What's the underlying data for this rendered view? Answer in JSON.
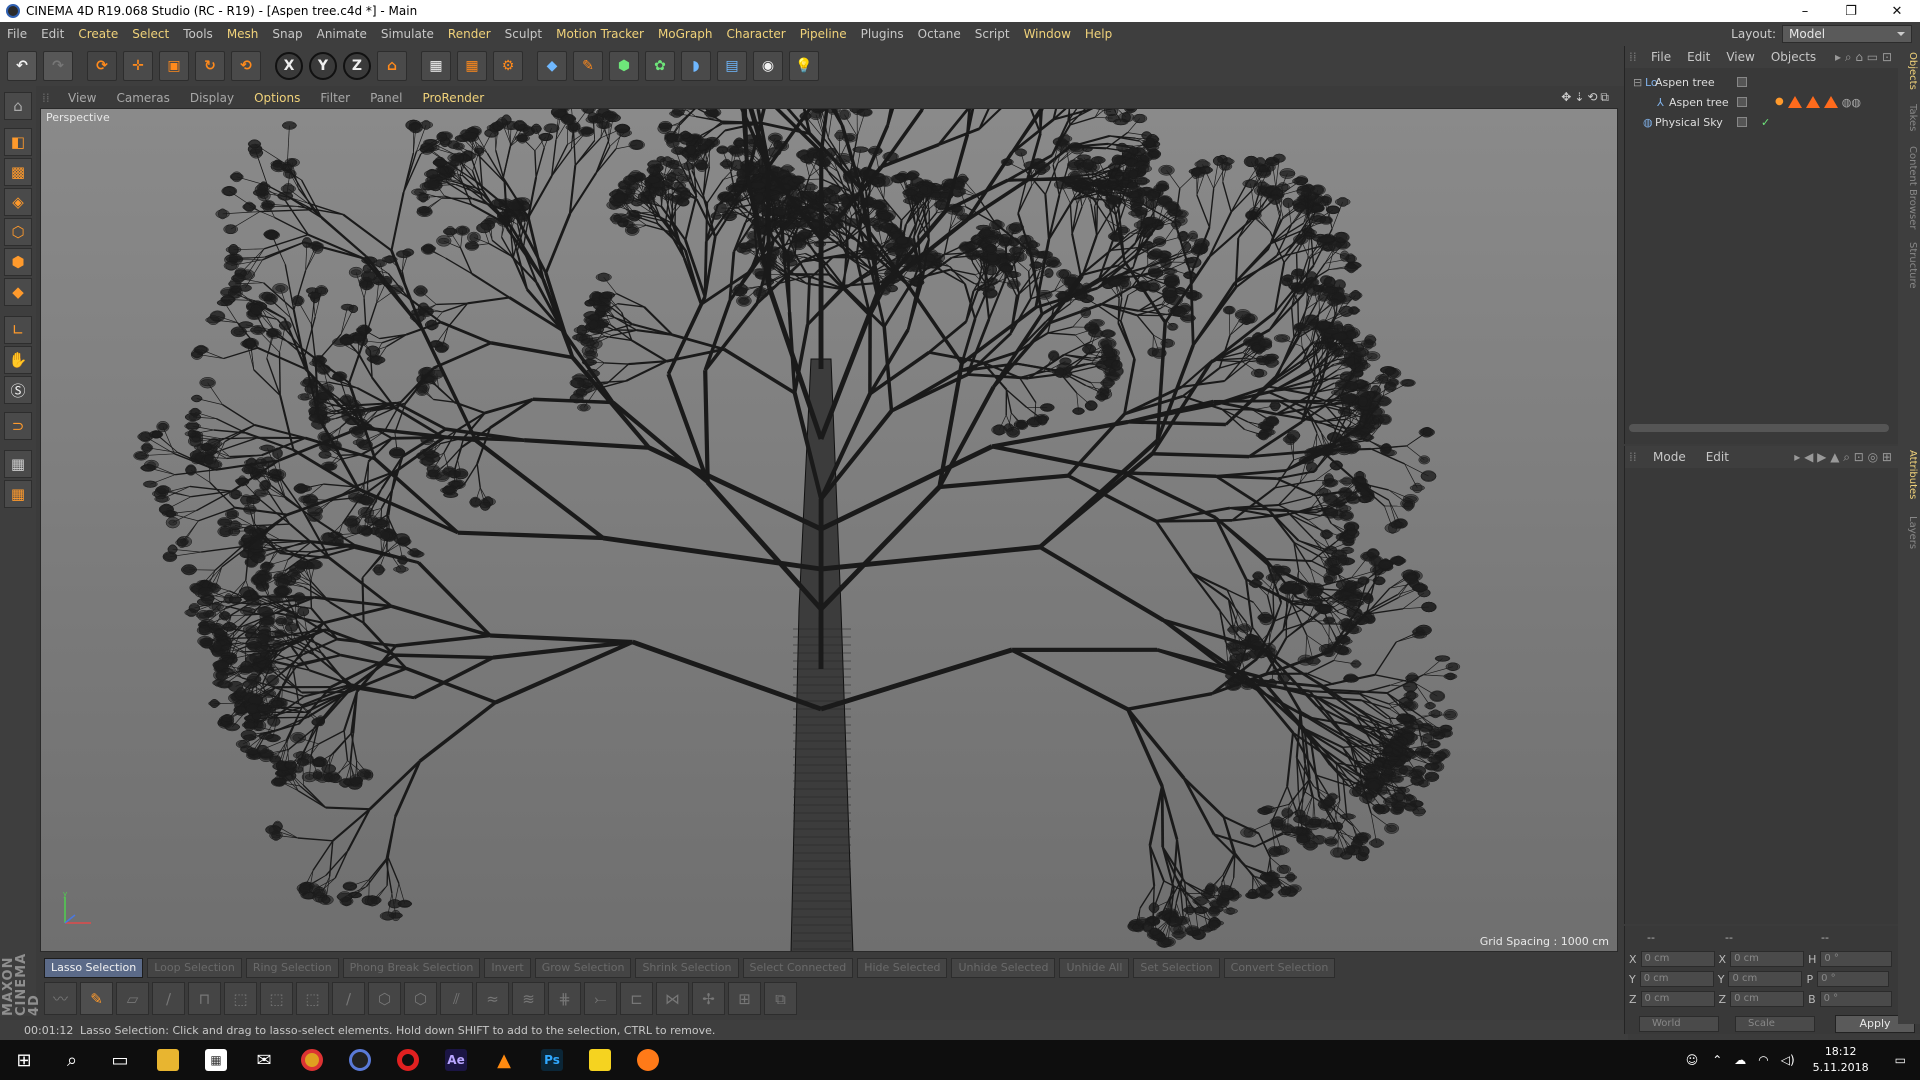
{
  "window": {
    "title": "CINEMA 4D R19.068 Studio (RC - R19) - [Aspen tree.c4d *] - Main",
    "controls": [
      "–",
      "❐",
      "✕"
    ]
  },
  "menu": {
    "items": [
      {
        "label": "File",
        "hl": false
      },
      {
        "label": "Edit",
        "hl": false
      },
      {
        "label": "Create",
        "hl": true
      },
      {
        "label": "Select",
        "hl": true
      },
      {
        "label": "Tools",
        "hl": false
      },
      {
        "label": "Mesh",
        "hl": true
      },
      {
        "label": "Snap",
        "hl": false
      },
      {
        "label": "Animate",
        "hl": false
      },
      {
        "label": "Simulate",
        "hl": false
      },
      {
        "label": "Render",
        "hl": true
      },
      {
        "label": "Sculpt",
        "hl": false
      },
      {
        "label": "Motion Tracker",
        "hl": true
      },
      {
        "label": "MoGraph",
        "hl": true
      },
      {
        "label": "Character",
        "hl": true
      },
      {
        "label": "Pipeline",
        "hl": true
      },
      {
        "label": "Plugins",
        "hl": false
      },
      {
        "label": "Octane",
        "hl": false
      },
      {
        "label": "Script",
        "hl": false
      },
      {
        "label": "Window",
        "hl": true
      },
      {
        "label": "Help",
        "hl": true
      }
    ],
    "layout_label": "Layout:",
    "layout_value": "Model"
  },
  "viewport": {
    "menu": [
      {
        "label": "View",
        "hl": false
      },
      {
        "label": "Cameras",
        "hl": false
      },
      {
        "label": "Display",
        "hl": false
      },
      {
        "label": "Options",
        "hl": true
      },
      {
        "label": "Filter",
        "hl": false
      },
      {
        "label": "Panel",
        "hl": false
      },
      {
        "label": "ProRender",
        "hl": true
      }
    ],
    "camera_label": "Perspective",
    "grid_spacing": "Grid Spacing : 1000 cm"
  },
  "command_bar": [
    {
      "label": "Lasso Selection",
      "active": true
    },
    {
      "label": "Loop Selection",
      "active": false
    },
    {
      "label": "Ring Selection",
      "active": false
    },
    {
      "label": "Phong Break Selection",
      "active": false
    },
    {
      "label": "Invert",
      "active": false
    },
    {
      "label": "Grow Selection",
      "active": false
    },
    {
      "label": "Shrink Selection",
      "active": false
    },
    {
      "label": "Select Connected",
      "active": false
    },
    {
      "label": "Hide Selected",
      "active": false
    },
    {
      "label": "Unhide Selected",
      "active": false
    },
    {
      "label": "Unhide All",
      "active": false
    },
    {
      "label": "Set Selection",
      "active": false
    },
    {
      "label": "Convert Selection",
      "active": false
    }
  ],
  "status": {
    "time": "00:01:12",
    "message": "Lasso Selection: Click and drag to lasso-select elements. Hold down SHIFT to add to the selection, CTRL to remove."
  },
  "branding": {
    "logo_text": "MAXON CINEMA 4D"
  },
  "object_manager": {
    "menu": [
      "File",
      "Edit",
      "View",
      "Objects"
    ],
    "objects": [
      {
        "name": "Aspen tree",
        "indent": 0
      },
      {
        "name": "Aspen tree",
        "indent": 1
      },
      {
        "name": "Physical Sky",
        "indent": 0
      }
    ]
  },
  "attributes": {
    "menu": [
      "Mode",
      "Edit"
    ]
  },
  "coordinates": {
    "rows": [
      {
        "a": "X",
        "v1": "0 cm",
        "b": "X",
        "v2": "0 cm",
        "c": "H",
        "v3": "0 °"
      },
      {
        "a": "Y",
        "v1": "0 cm",
        "b": "Y",
        "v2": "0 cm",
        "c": "P",
        "v3": "0 °"
      },
      {
        "a": "Z",
        "v1": "0 cm",
        "b": "Z",
        "v2": "0 cm",
        "c": "B",
        "v3": "0 °"
      }
    ],
    "header": [
      "--",
      "--",
      "--"
    ],
    "world": "World",
    "scale": "Scale",
    "apply": "Apply"
  },
  "right_tabs": [
    "Objects",
    "Takes",
    "Content Browser",
    "Structure",
    "Attributes",
    "Layers"
  ],
  "taskbar": {
    "time": "18:12",
    "date": "5.11.2018"
  },
  "colors": {
    "accent_orange": "#ff9a2c",
    "menu_highlight": "#f0d27a",
    "active_command": "#5b6a88"
  }
}
